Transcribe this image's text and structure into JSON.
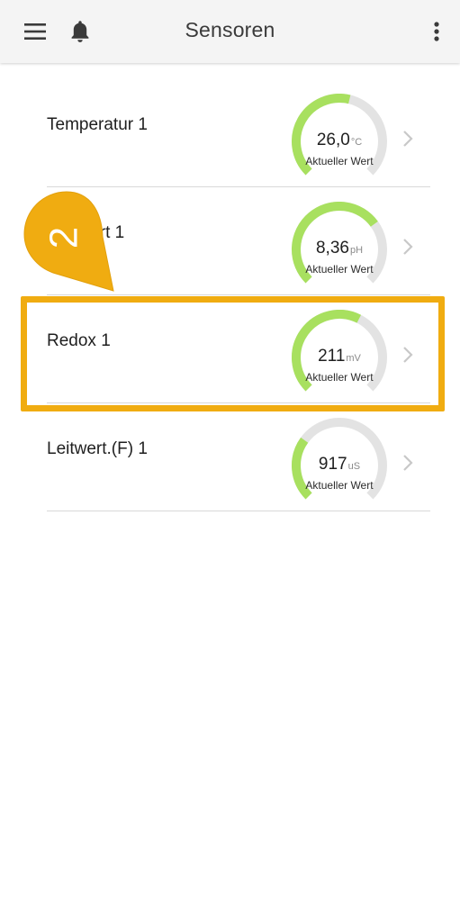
{
  "appbar": {
    "title": "Sensoren",
    "icons": {
      "menu": "hamburger-menu-icon",
      "notifications": "bell-icon",
      "more": "more-vertical-icon"
    }
  },
  "sensors": [
    {
      "name": "Temperatur 1",
      "value": "26,0",
      "unit": "°C",
      "caption": "Aktueller Wert",
      "gauge_fill": 0.55
    },
    {
      "name": "pH-Wert 1",
      "value": "8,36",
      "unit": "pH",
      "caption": "Aktueller Wert",
      "gauge_fill": 0.7
    },
    {
      "name": "Redox 1",
      "value": "211",
      "unit": "mV",
      "caption": "Aktueller Wert",
      "gauge_fill": 0.6
    },
    {
      "name": "Leitwert.(F) 1",
      "value": "917",
      "unit": "uS",
      "caption": "Aktueller Wert",
      "gauge_fill": 0.3
    }
  ],
  "tutorial": {
    "step_number": "2",
    "highlighted_item": "Redox 1"
  },
  "colors": {
    "appbar_bg": "#f4f4f4",
    "gauge_fill": "#a8e05f",
    "gauge_track": "#e3e3e3",
    "highlight": "#f0ac11",
    "divider": "#d9d9d9"
  }
}
